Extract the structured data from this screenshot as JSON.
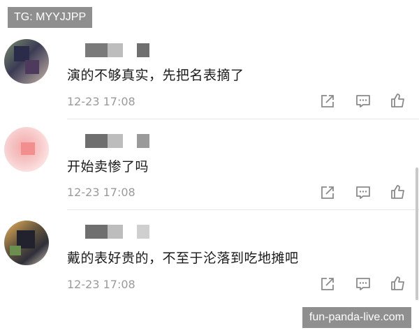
{
  "watermark_top": "TG: MYYJJPP",
  "watermark_bottom": "fun-panda-live.com",
  "comments": [
    {
      "text": "演的不够真实，先把名表摘了",
      "time": "12-23 17:08"
    },
    {
      "text": "开始卖惨了吗",
      "time": "12-23 17:08"
    },
    {
      "text": "戴的表好贵的，不至于沦落到吃地摊吧",
      "time": "12-23 17:08"
    }
  ],
  "actions": [
    "share-icon",
    "comment-icon",
    "like-icon"
  ],
  "colors": {
    "text": "#1a1a1a",
    "time": "#9a9a9a",
    "icon": "#8a8a8a",
    "watermark_bg": "#8f8f8f"
  }
}
